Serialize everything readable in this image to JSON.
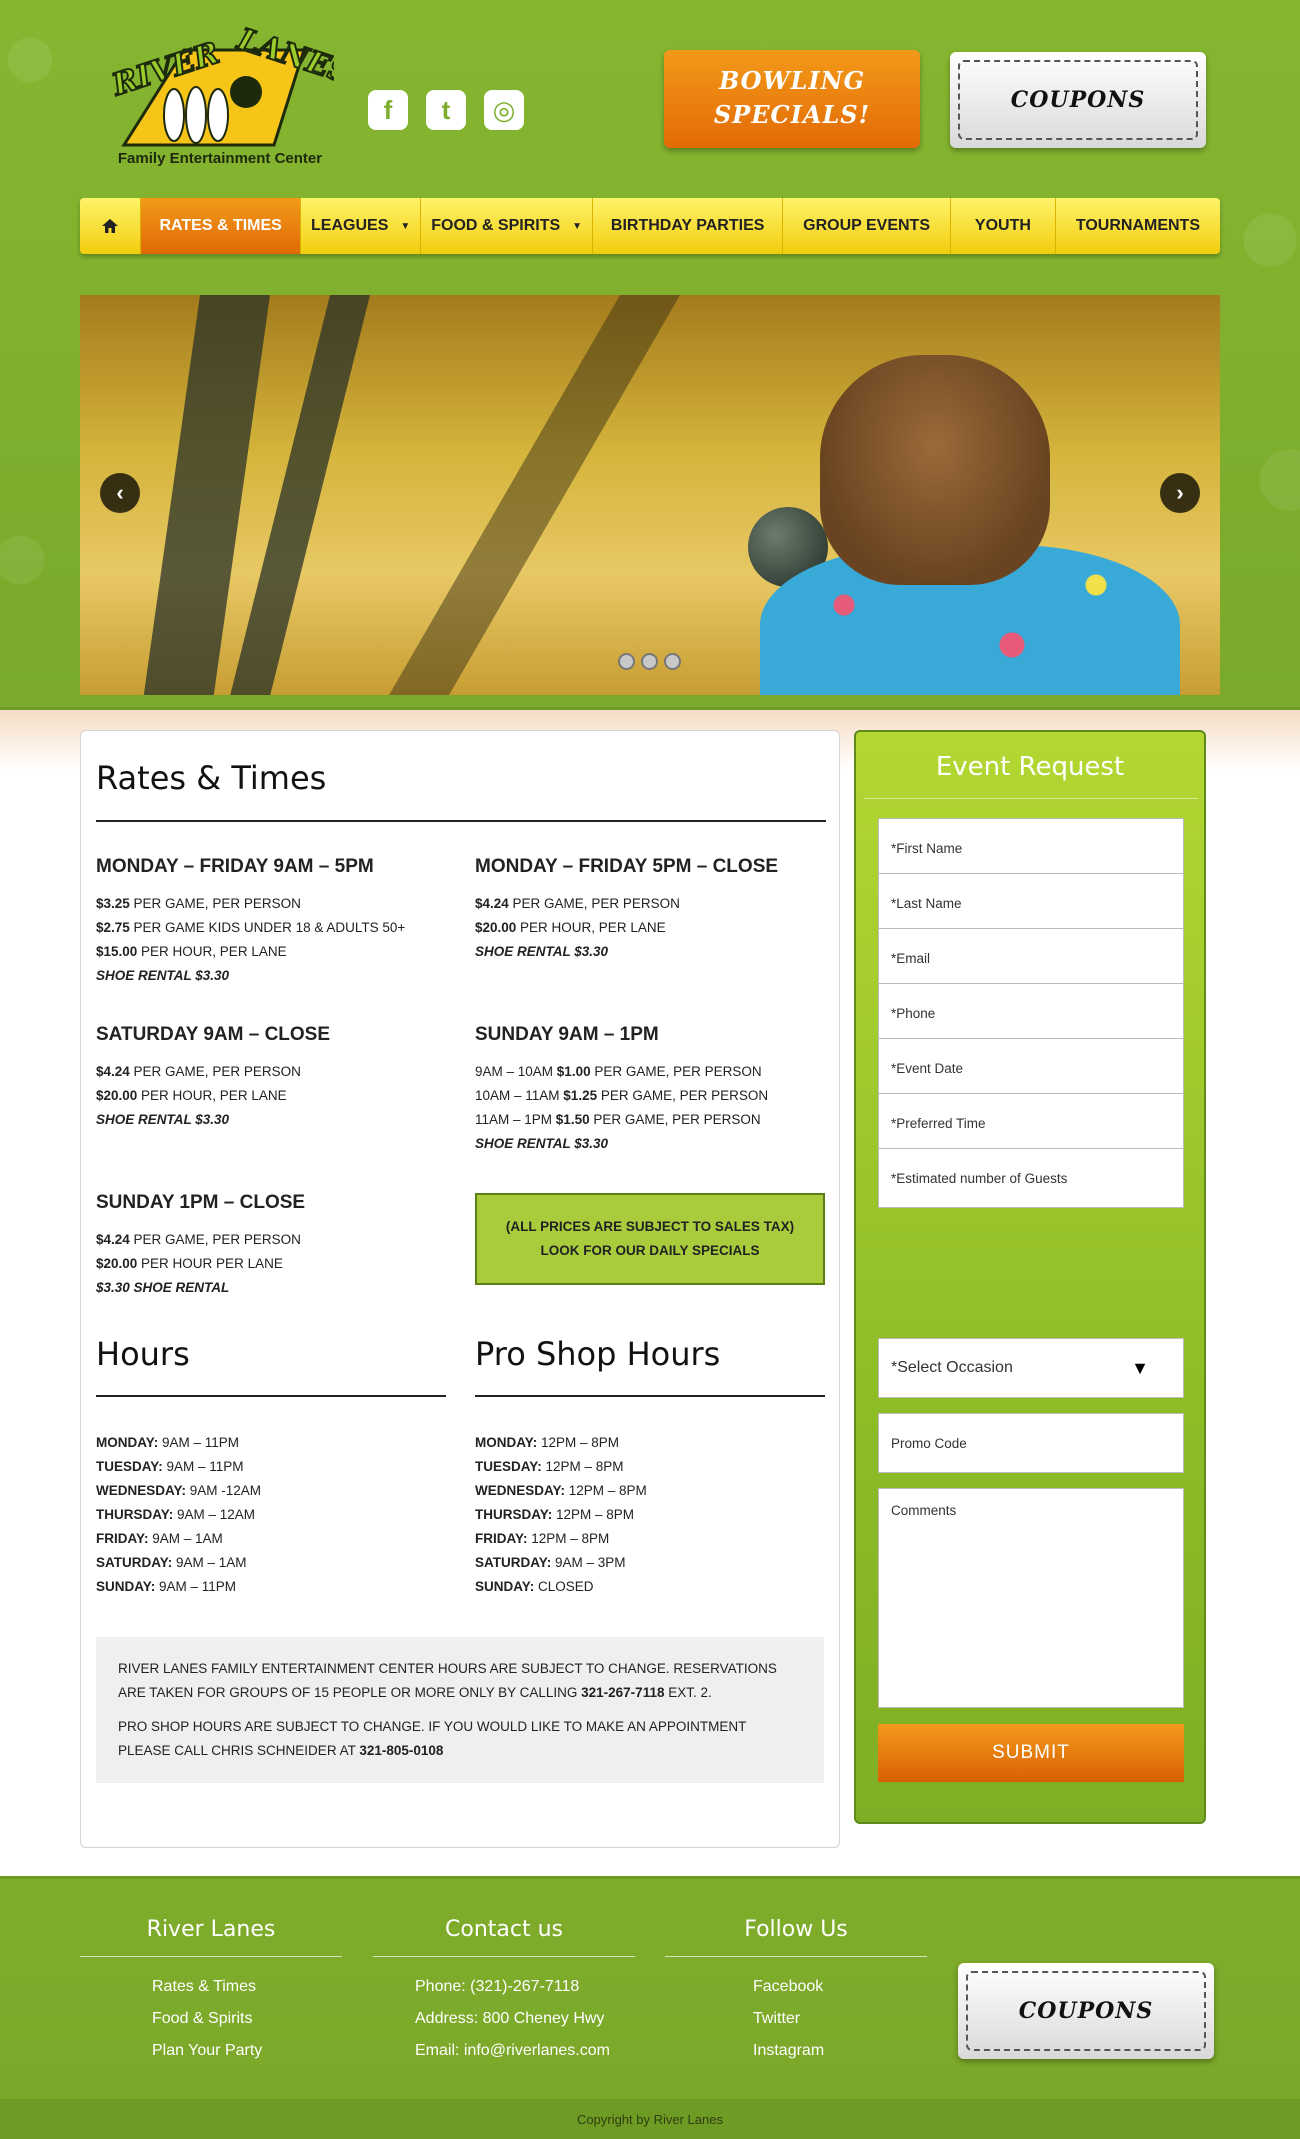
{
  "header": {
    "logo_text": "River Lanes",
    "logo_subtitle": "Family Entertainment Center",
    "social": [
      {
        "icon": "facebook-icon",
        "glyph": "f"
      },
      {
        "icon": "twitter-icon",
        "glyph": "t"
      },
      {
        "icon": "instagram-icon",
        "glyph": "◎"
      }
    ],
    "specials_label": "BOWLING SPECIALS!",
    "coupons_label": "COUPONS"
  },
  "nav": {
    "items": [
      {
        "label": "RATES & TIMES",
        "active": true
      },
      {
        "label": "LEAGUES",
        "dropdown": true
      },
      {
        "label": "FOOD & SPIRITS",
        "dropdown": true
      },
      {
        "label": "BIRTHDAY PARTIES"
      },
      {
        "label": "GROUP EVENTS"
      },
      {
        "label": "YOUTH"
      },
      {
        "label": "TOURNAMENTS"
      }
    ]
  },
  "slider": {
    "prev": "‹",
    "next": "›"
  },
  "content": {
    "title": "Rates & Times",
    "blocks": [
      {
        "heading": "MONDAY – FRIDAY 9AM – 5PM",
        "lines": [
          {
            "bold": "$3.25",
            "text": " PER GAME, PER PERSON"
          },
          {
            "bold": "$2.75",
            "text": " PER GAME KIDS UNDER 18 & ADULTS 50+"
          },
          {
            "bold": "$15.00",
            "text": " PER HOUR, PER LANE"
          },
          {
            "italic": "SHOE RENTAL $3.30"
          }
        ]
      },
      {
        "heading": "MONDAY – FRIDAY 5PM – CLOSE",
        "lines": [
          {
            "bold": "$4.24",
            "text": " PER GAME, PER PERSON"
          },
          {
            "bold": "$20.00",
            "text": " PER HOUR, PER LANE"
          },
          {
            "italic": "SHOE RENTAL $3.30"
          }
        ]
      },
      {
        "heading": "SATURDAY 9AM – CLOSE",
        "lines": [
          {
            "bold": "$4.24",
            "text": " PER GAME, PER PERSON"
          },
          {
            "bold": "$20.00",
            "text": " PER HOUR, PER LANE"
          },
          {
            "italic": "SHOE RENTAL $3.30"
          }
        ]
      },
      {
        "heading": "SUNDAY 9AM – 1PM",
        "lines": [
          {
            "pre": "9AM – 10AM ",
            "bold": "$1.00",
            "text": " PER GAME, PER PERSON"
          },
          {
            "pre": "10AM – 11AM ",
            "bold": "$1.25",
            "text": " PER GAME, PER PERSON"
          },
          {
            "pre": "11AM – 1PM ",
            "bold": "$1.50",
            "text": " PER GAME, PER PERSON"
          },
          {
            "italic": "SHOE RENTAL $3.30"
          }
        ]
      },
      {
        "heading": "SUNDAY 1PM – CLOSE",
        "lines": [
          {
            "bold": "$4.24",
            "text": " PER GAME, PER PERSON"
          },
          {
            "bold": "$20.00",
            "text": " PER HOUR PER LANE"
          },
          {
            "italic": "$3.30 SHOE RENTAL"
          }
        ]
      }
    ],
    "tax_note": [
      "(ALL PRICES ARE SUBJECT TO SALES TAX)",
      "LOOK FOR OUR DAILY SPECIALS"
    ],
    "hours_title": "Hours",
    "hours": [
      {
        "day": "MONDAY:",
        "time": " 9AM – 11PM"
      },
      {
        "day": "TUESDAY:",
        "time": " 9AM – 11PM"
      },
      {
        "day": "WEDNESDAY:",
        "time": " 9AM -12AM"
      },
      {
        "day": "THURSDAY:",
        "time": " 9AM – 12AM"
      },
      {
        "day": "FRIDAY:",
        "time": " 9AM – 1AM"
      },
      {
        "day": "SATURDAY:",
        "time": " 9AM – 1AM"
      },
      {
        "day": "SUNDAY:",
        "time": " 9AM – 11PM"
      }
    ],
    "proshop_title": "Pro Shop Hours",
    "proshop_hours": [
      {
        "day": "MONDAY:",
        "time": " 12PM – 8PM"
      },
      {
        "day": "TUESDAY:",
        "time": " 12PM – 8PM"
      },
      {
        "day": "WEDNESDAY:",
        "time": " 12PM – 8PM"
      },
      {
        "day": "THURSDAY:",
        "time": " 12PM – 8PM"
      },
      {
        "day": "FRIDAY:",
        "time": " 12PM – 8PM"
      },
      {
        "day": "SATURDAY:",
        "time": " 9AM – 3PM"
      },
      {
        "day": "SUNDAY:",
        "time": " CLOSED"
      }
    ],
    "notice": {
      "p1_text": "RIVER LANES FAMILY ENTERTAINMENT CENTER HOURS ARE SUBJECT TO CHANGE. RESERVATIONS ARE TAKEN FOR GROUPS OF 15 PEOPLE OR MORE ONLY BY CALLING ",
      "p1_phone": "321-267-7118",
      "p1_end": " EXT. 2.",
      "p2_text": "PRO SHOP HOURS ARE SUBJECT TO CHANGE. IF YOU WOULD LIKE TO MAKE AN APPOINTMENT PLEASE CALL CHRIS SCHNEIDER AT ",
      "p2_phone": "321-805-0108"
    }
  },
  "form": {
    "title": "Event Request",
    "fields": [
      "*First Name",
      "*Last Name",
      "*Email",
      "*Phone",
      "*Event Date",
      "*Preferred Time",
      "*Estimated number of Guests"
    ],
    "occasion": "*Select Occasion",
    "promo": "Promo Code",
    "comments": "Comments",
    "submit": "SUBMIT"
  },
  "footer": {
    "col1_title": "River Lanes",
    "col1_links": [
      "Rates & Times",
      "Food & Spirits",
      "Plan Your Party"
    ],
    "col2_title": "Contact us",
    "col2_lines": [
      "Phone: (321)-267-7118",
      "Address: 800 Cheney Hwy",
      "Email: info@riverlanes.com"
    ],
    "col3_title": "Follow Us",
    "col3_links": [
      "Facebook",
      "Twitter",
      "Instagram"
    ],
    "coupons_label": "COUPONS",
    "copyright": "Copyright by River Lanes"
  },
  "colors": {
    "brand_green": "#7eae2d",
    "nav_yellow": "#f2cd0d",
    "accent_orange": "#e26a05",
    "tax_box_green": "#a9cc3c"
  }
}
